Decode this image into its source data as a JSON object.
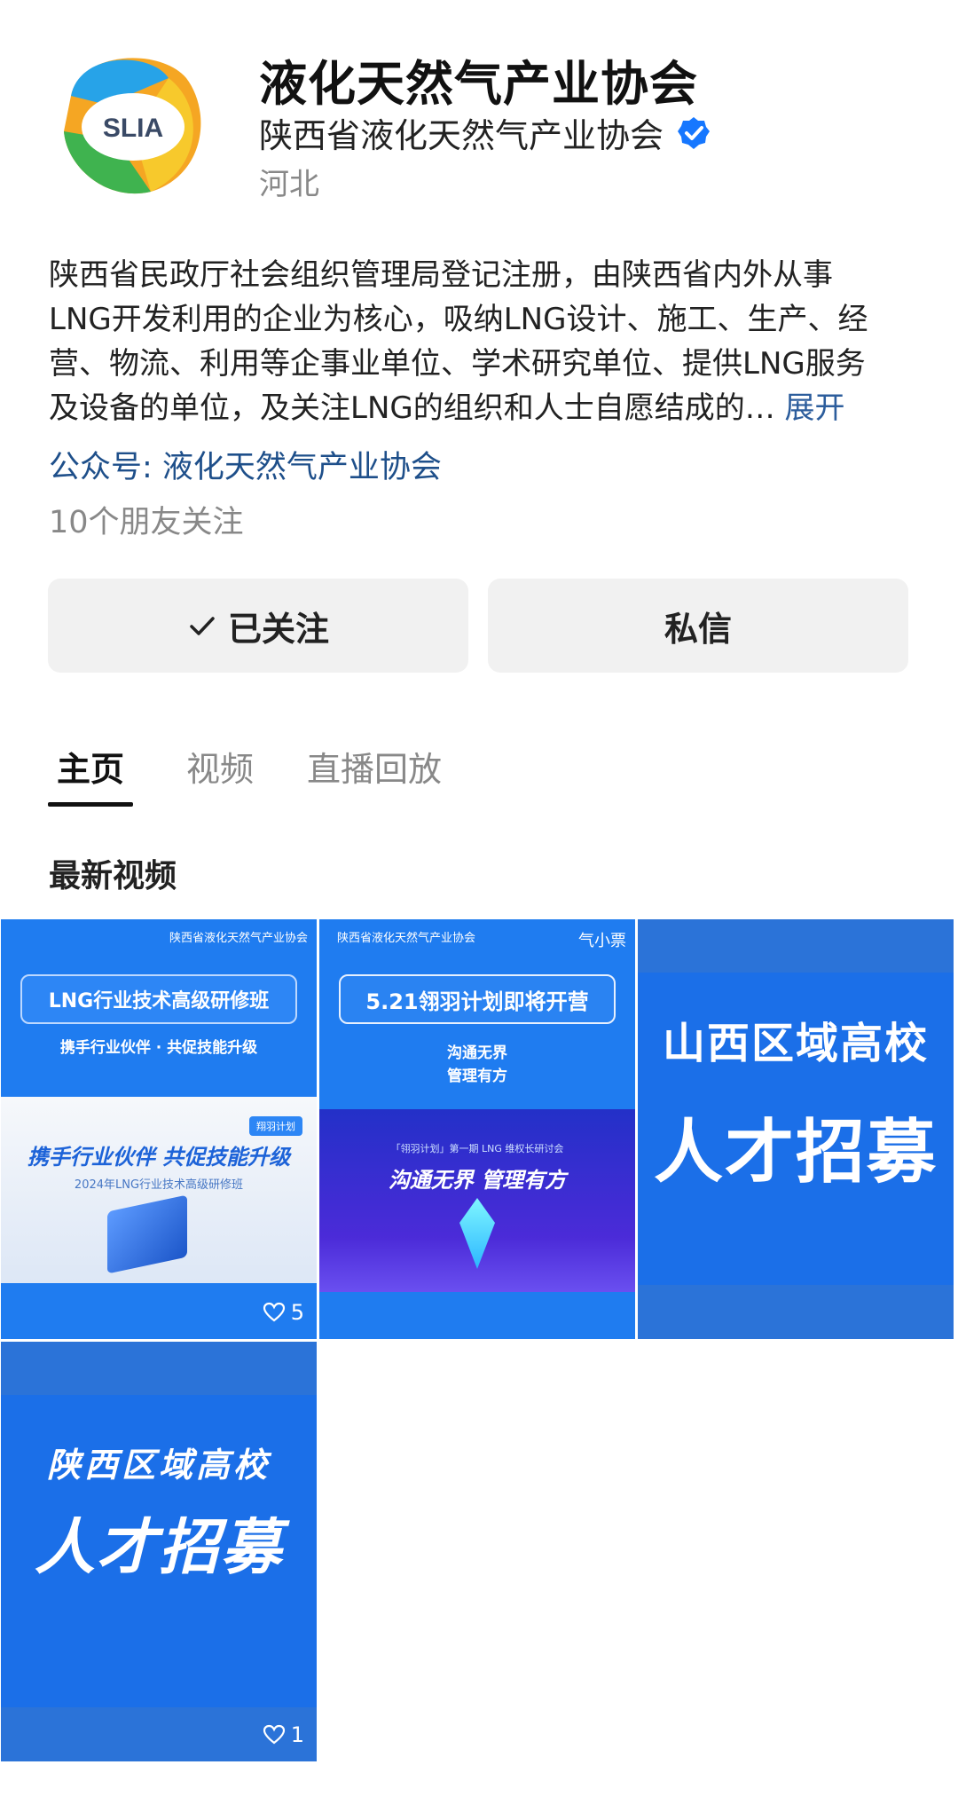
{
  "header": {
    "title": "液化天然气产业协会",
    "subtitle": "陕西省液化天然气产业协会",
    "location": "河北",
    "logo_text": "SLIA"
  },
  "description": {
    "lines": [
      "陕西省民政厅社会组织管理局登记注册，由陕西省内外从事",
      "LNG开发利用的企业为核心，吸纳LNG设计、施工、生产、经",
      "营、物流、利用等企事业单位、学术研究单位、提供LNG服务",
      "及设备的单位，及关注LNG的组织和人士自愿结成的…"
    ],
    "expand_label": "展开"
  },
  "account_label": "公众号: 液化天然气产业协会",
  "friends_label": "10个朋友关注",
  "buttons": {
    "follow": "已关注",
    "message": "私信"
  },
  "tabs": [
    "主页",
    "视频",
    "直播回放"
  ],
  "section_title": "最新视频",
  "videos": [
    {
      "org": "陕西省液化天然气产业协会",
      "headline": "LNG行业技术高级研修班",
      "tagline": "携手行业伙伴 · 共促技能升级",
      "badge": "翔羽计划",
      "poster_big": "携手行业伙伴 共促技能升级",
      "poster_small": "2024年LNG行业技术高级研修班",
      "likes": "5"
    },
    {
      "org": "陕西省液化天然气产业协会",
      "brand": "气小票",
      "headline": "5.21翎羽计划即将开营",
      "tagline_lines": [
        "沟通无界",
        "管理有方"
      ],
      "poster_small": "「翎羽计划」第一期 LNG 维权长研讨会",
      "poster_big": "沟通无界 管理有方"
    },
    {
      "line1": "山西区域高校",
      "line2": "人才招募"
    },
    {
      "line1": "陕西区域高校",
      "line2": "人才招募",
      "likes": "1"
    }
  ],
  "colors": {
    "verified": "#1677ff",
    "link": "#1e4f8a",
    "thumb_blue": "#1f7cf0"
  }
}
